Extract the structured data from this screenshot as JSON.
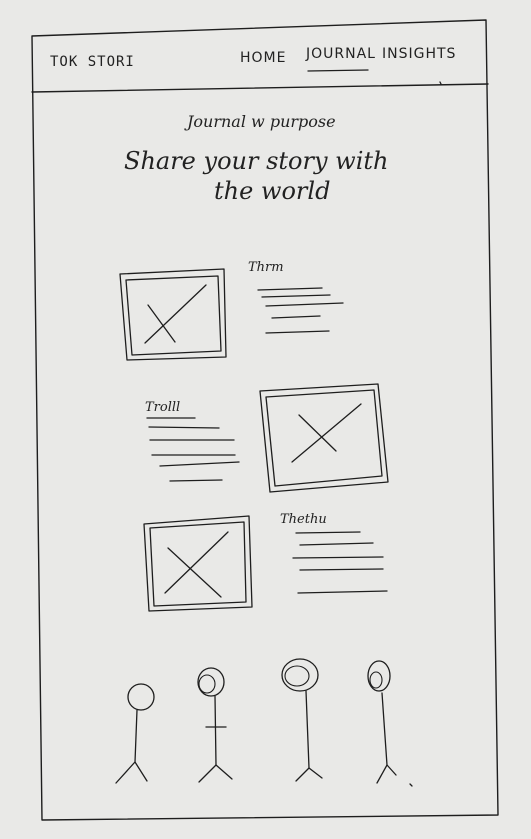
{
  "header": {
    "logo": "TOK STORI",
    "nav": [
      {
        "label": "HOME"
      },
      {
        "label": "JOURNAL"
      },
      {
        "label": "INSIGHTS"
      }
    ]
  },
  "hero": {
    "eyebrow": "Journal w purpose",
    "headline_line1": "Share your story with",
    "headline_line2": "the world"
  },
  "cards": [
    {
      "label": "Thrm"
    },
    {
      "label": "Trolll"
    },
    {
      "label": "Thethu"
    }
  ],
  "icons": {
    "image_placeholder": "image-placeholder-icon",
    "person": "person-icon"
  }
}
